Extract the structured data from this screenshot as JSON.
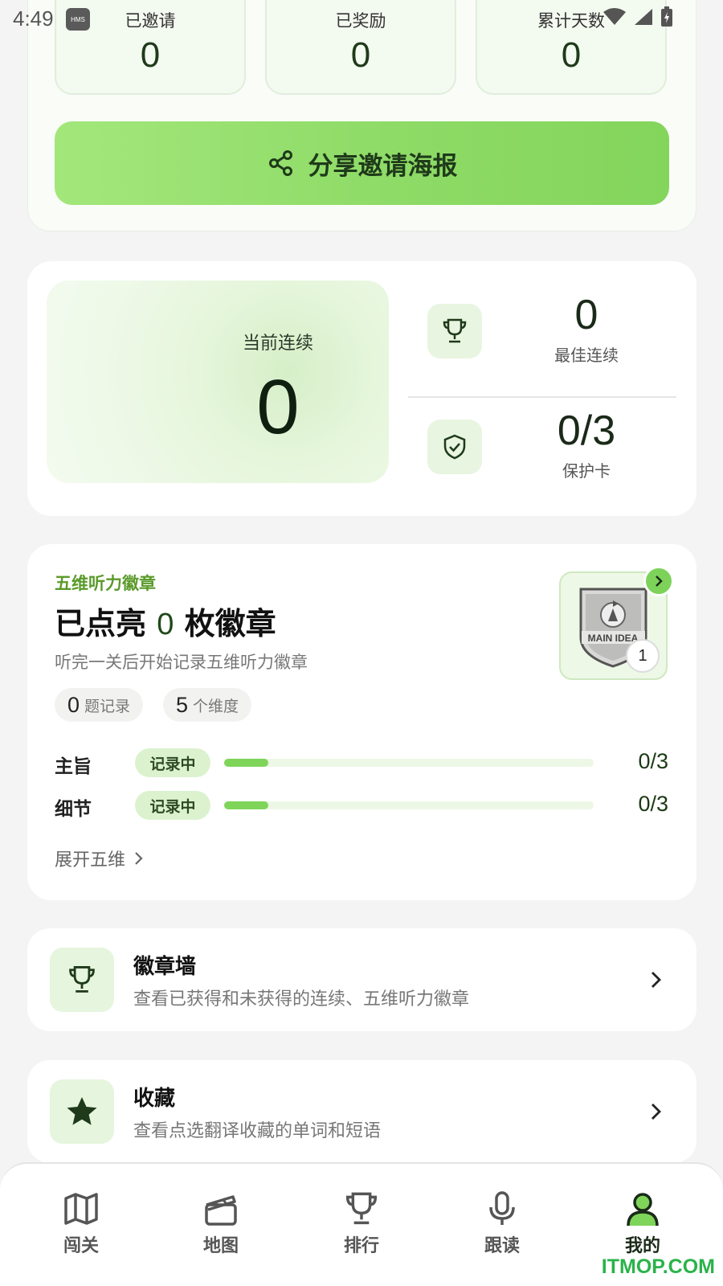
{
  "status_bar": {
    "time": "4:49",
    "hms": "HMS"
  },
  "invite": {
    "stats": [
      {
        "label": "已邀请",
        "value": "0"
      },
      {
        "label": "已奖励",
        "value": "0"
      },
      {
        "label": "累计天数",
        "value": "0"
      }
    ],
    "share_label": "分享邀请海报"
  },
  "streak": {
    "current_label": "当前连续",
    "current_value": "0",
    "best_value": "0",
    "best_label": "最佳连续",
    "protect_value": "0/3",
    "protect_label": "保护卡"
  },
  "badges": {
    "eyebrow": "五维听力徽章",
    "title_prefix": "已点亮",
    "title_count": "0",
    "title_suffix": "枚徽章",
    "subtitle": "听完一关后开始记录五维听力徽章",
    "chips": [
      {
        "num": "0",
        "text": "题记录"
      },
      {
        "num": "5",
        "text": "个维度"
      }
    ],
    "thumb_text": "MAIN IDEA",
    "thumb_count": "1",
    "dimensions": [
      {
        "name": "主旨",
        "status": "记录中",
        "score": "0/3",
        "progress": 0.12
      },
      {
        "name": "细节",
        "status": "记录中",
        "score": "0/3",
        "progress": 0.12
      }
    ],
    "expand_label": "展开五维"
  },
  "list": [
    {
      "title": "徽章墙",
      "desc": "查看已获得和未获得的连续、五维听力徽章",
      "icon": "trophy-icon"
    },
    {
      "title": "收藏",
      "desc": "查看点选翻译收藏的单词和短语",
      "icon": "star-icon"
    }
  ],
  "nav": [
    {
      "label": "闯关",
      "icon": "map-icon"
    },
    {
      "label": "地图",
      "icon": "clapperboard-icon"
    },
    {
      "label": "排行",
      "icon": "trophy-icon"
    },
    {
      "label": "跟读",
      "icon": "microphone-icon"
    },
    {
      "label": "我的",
      "icon": "user-icon",
      "active": true
    }
  ],
  "watermark": "ITMOP.COM",
  "colors": {
    "accent": "#7fd55a",
    "text_dark": "#1a2a18",
    "chip_bg": "#dcf2cf"
  }
}
